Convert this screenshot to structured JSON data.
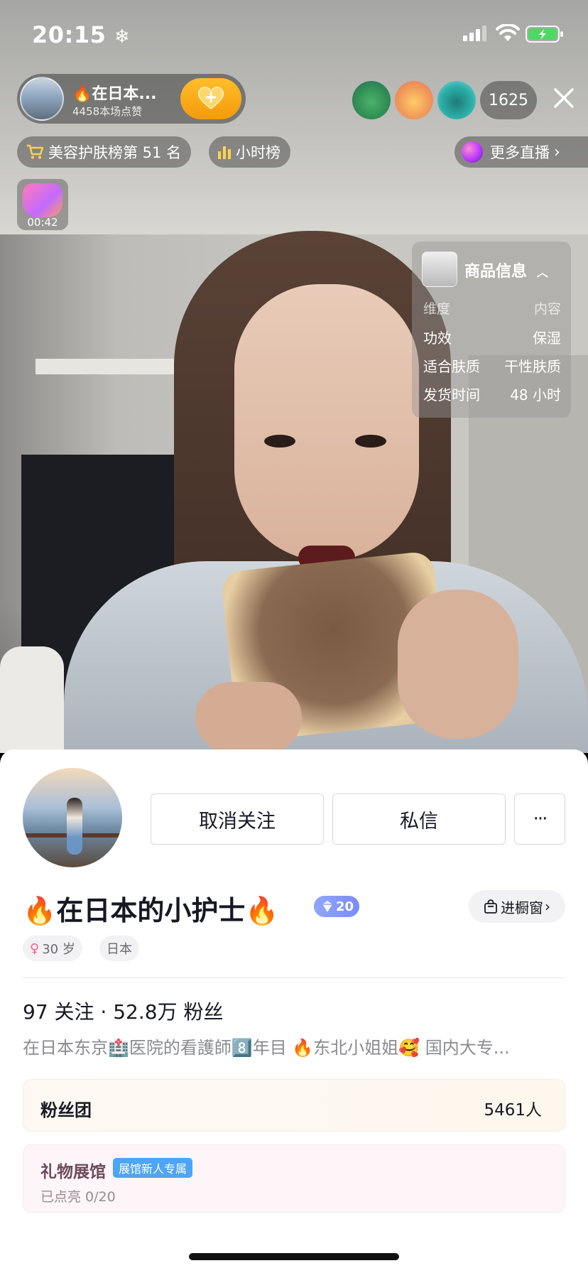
{
  "status_bar": {
    "time": "20:15",
    "time_extra_icon": "snowflake-icon",
    "icons": [
      "signal-icon",
      "wifi-icon",
      "battery-charging-icon"
    ]
  },
  "live_header": {
    "host_name": "🔥在日本...",
    "host_likes": "4458本场点赞",
    "follow_icon": "heart-plus-icon",
    "viewer_count": "1625",
    "close_icon": "close-icon"
  },
  "rank_bar": {
    "beauty_rank": "美容护肤榜第 51 名",
    "hour_rank": "小时榜",
    "more_live": "更多直播"
  },
  "gift_timer": {
    "time": "00:42"
  },
  "product_info": {
    "title": "商品信息",
    "header": {
      "key": "维度",
      "value": "内容"
    },
    "rows": [
      {
        "key": "功效",
        "value": "保湿"
      },
      {
        "key": "适合肤质",
        "value": "干性肤质"
      },
      {
        "key": "发货时间",
        "value": "48 小时"
      }
    ]
  },
  "profile": {
    "unfollow_label": "取消关注",
    "dm_label": "私信",
    "more_label": "···",
    "nickname": "🔥在日本的小护士🔥",
    "level": "20",
    "showcase_label": "进橱窗",
    "tags": [
      "30 岁",
      "日本"
    ],
    "stats": "97 关注 · 52.8万 粉丝",
    "bio": "在日本东京🏥医院的看護師8️⃣年目 🔥东北小姐姐🥰  国内大专..."
  },
  "fans_club": {
    "label": "粉丝团",
    "count": "5461人"
  },
  "gift_hall": {
    "label": "礼物展馆",
    "badge": "展馆新人专属",
    "progress_text": "已点亮 0/20"
  },
  "colors": {
    "accent_orange": "#f59a0c",
    "level_badge": "#7b8cf5",
    "new_badge": "#4ea4f5",
    "battery_green": "#4cd964"
  }
}
